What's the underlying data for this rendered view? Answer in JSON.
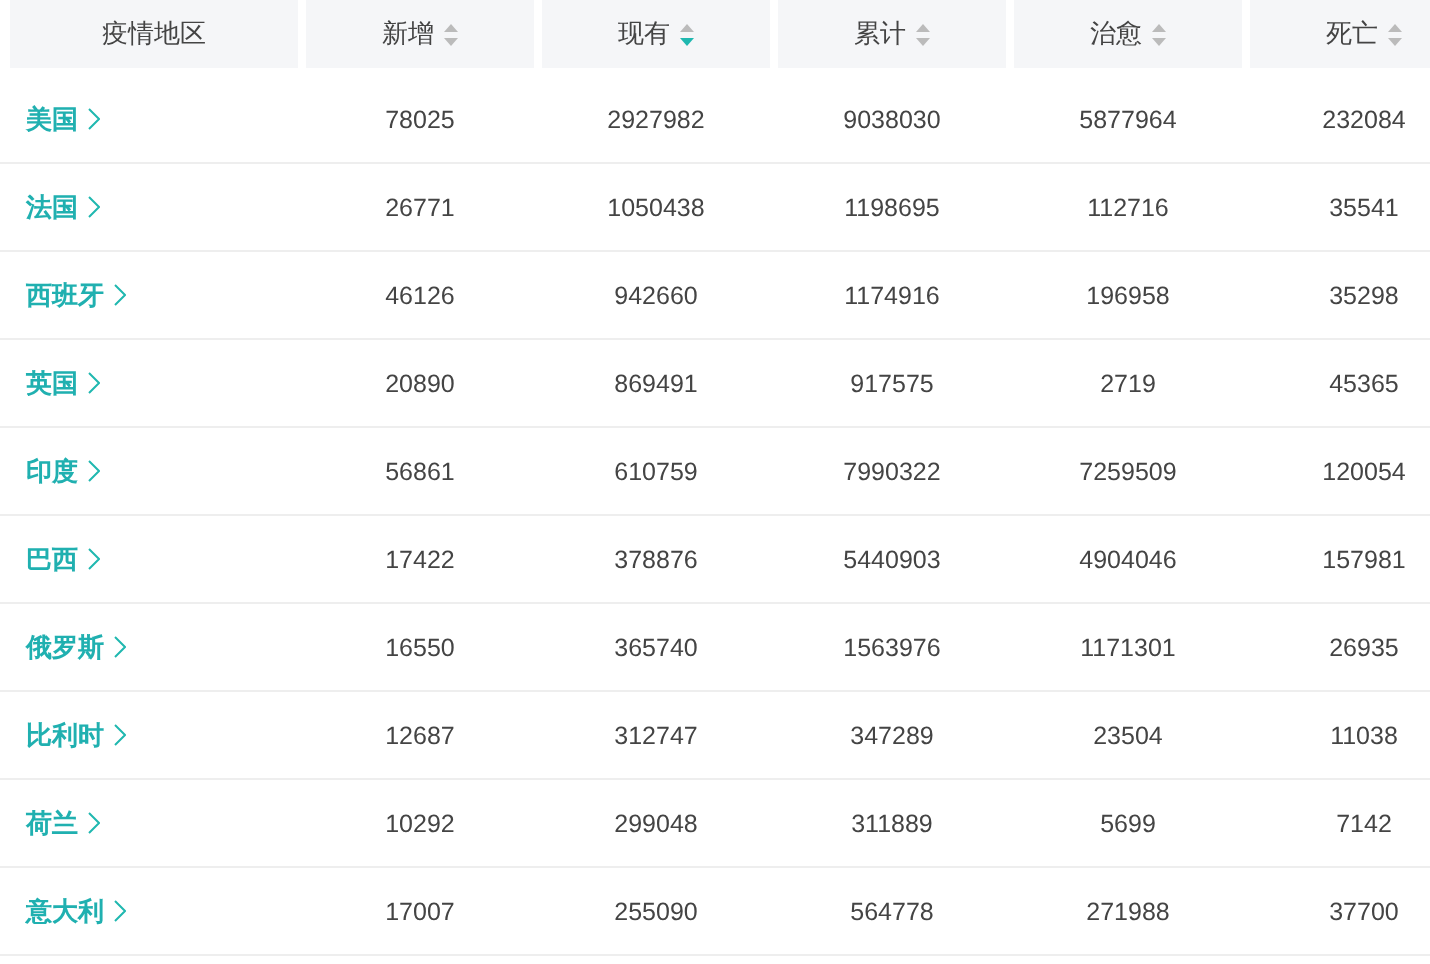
{
  "table": {
    "columns": [
      {
        "label": "疫情地区",
        "sortable": false
      },
      {
        "label": "新增",
        "sortable": true,
        "sorted_descending": false
      },
      {
        "label": "现有",
        "sortable": true,
        "sorted_descending": true
      },
      {
        "label": "累计",
        "sortable": true,
        "sorted_descending": false
      },
      {
        "label": "治愈",
        "sortable": true,
        "sorted_descending": false
      },
      {
        "label": "死亡",
        "sortable": true,
        "sorted_descending": false
      }
    ],
    "rows": [
      {
        "cells": [
          "美国",
          "78025",
          "2927982",
          "9038030",
          "5877964",
          "232084"
        ]
      },
      {
        "cells": [
          "法国",
          "26771",
          "1050438",
          "1198695",
          "112716",
          "35541"
        ]
      },
      {
        "cells": [
          "西班牙",
          "46126",
          "942660",
          "1174916",
          "196958",
          "35298"
        ]
      },
      {
        "cells": [
          "英国",
          "20890",
          "869491",
          "917575",
          "2719",
          "45365"
        ]
      },
      {
        "cells": [
          "印度",
          "56861",
          "610759",
          "7990322",
          "7259509",
          "120054"
        ]
      },
      {
        "cells": [
          "巴西",
          "17422",
          "378876",
          "5440903",
          "4904046",
          "157981"
        ]
      },
      {
        "cells": [
          "俄罗斯",
          "16550",
          "365740",
          "1563976",
          "1171301",
          "26935"
        ]
      },
      {
        "cells": [
          "比利时",
          "12687",
          "312747",
          "347289",
          "23504",
          "11038"
        ]
      },
      {
        "cells": [
          "荷兰",
          "10292",
          "299048",
          "311889",
          "5699",
          "7142"
        ]
      },
      {
        "cells": [
          "意大利",
          "17007",
          "255090",
          "564778",
          "271988",
          "37700"
        ]
      }
    ]
  }
}
